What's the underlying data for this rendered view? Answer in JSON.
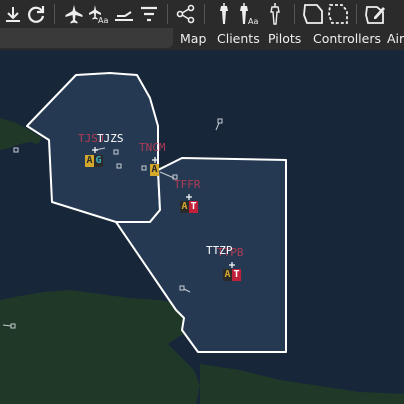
{
  "toolbar": {
    "icons": [
      "download-icon",
      "refresh-icon",
      "airplane-icon",
      "airplane-label-icon",
      "runway-icon",
      "filter-icon",
      "share-network-icon",
      "tower-icon",
      "tower-label-icon",
      "tower-outline-icon",
      "sector-solid-icon",
      "sector-dashed-icon",
      "sector-edit-icon"
    ]
  },
  "menu": {
    "items": [
      "Map",
      "Clients",
      "Pilots",
      "Controllers",
      "Air"
    ]
  },
  "map": {
    "colors": {
      "sea": "#18263a",
      "land": "#1f3828",
      "fir_fill": "#253a52",
      "fir_border": "#ffffff",
      "label_inactive": "#b03a55",
      "label_active": "#ffffff",
      "badge_app": "#d4a82a",
      "badge_gnd": "#3ab0c0",
      "badge_twr": "#c0203a",
      "badge_dark": "#2a2a2a"
    },
    "airports": [
      {
        "id": "TJSJ",
        "name_inactive": "TJSJ",
        "name_active": "TJZS",
        "badge": [
          "A",
          "G"
        ]
      },
      {
        "id": "TNCM",
        "name_inactive": "TNCM",
        "badge": [
          "A"
        ]
      },
      {
        "id": "TFFR",
        "name_inactive": "TFFR",
        "badge": [
          "A",
          "T"
        ]
      },
      {
        "id": "TTZP",
        "name_inactive": "TTPB",
        "name_active": "TTZP",
        "badge": [
          "A",
          "T"
        ]
      }
    ]
  }
}
